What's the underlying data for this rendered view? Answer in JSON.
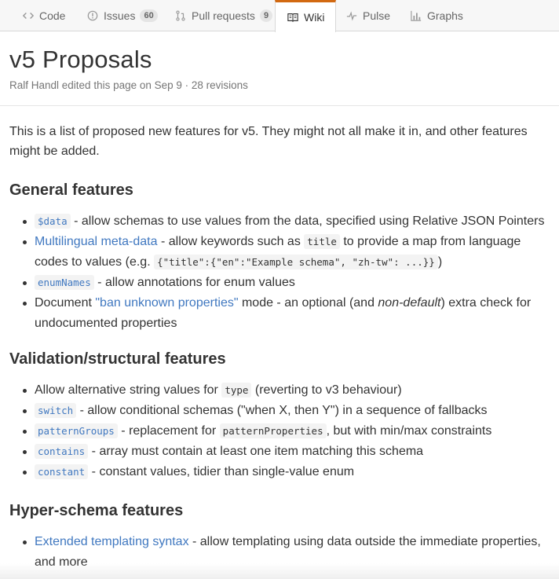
{
  "tabs": [
    {
      "label": "Code",
      "icon": "code-icon"
    },
    {
      "label": "Issues",
      "icon": "issue-opened-icon",
      "count": "60"
    },
    {
      "label": "Pull requests",
      "icon": "git-pull-request-icon",
      "count": "9"
    },
    {
      "label": "Wiki",
      "icon": "book-icon",
      "active": true
    },
    {
      "label": "Pulse",
      "icon": "pulse-icon"
    },
    {
      "label": "Graphs",
      "icon": "graph-icon"
    }
  ],
  "page": {
    "title": "v5 Proposals",
    "meta": "Ralf Handl edited this page on Sep 9 · 28 revisions",
    "intro": "This is a list of proposed new features for v5. They might not all make it in, and other features might be added."
  },
  "sections": {
    "general": {
      "heading": "General features",
      "i0": {
        "code": "$data",
        "text": " - allow schemas to use values from the data, specified using Relative JSON Pointers"
      },
      "i1": {
        "link": "Multilingual meta-data",
        "text_a": " - allow keywords such as ",
        "code_a": "title",
        "text_b": " to provide a map from language codes to values (e.g. ",
        "code_b": "{\"title\":{\"en\":\"Example schema\", \"zh-tw\": ...}}",
        "text_c": ")"
      },
      "i2": {
        "code": "enumNames",
        "text": " - allow annotations for enum values"
      },
      "i3": {
        "text_a": "Document ",
        "link": "\"ban unknown properties\"",
        "text_b": " mode - an optional (and ",
        "em": "non-default",
        "text_c": ") extra check for undocumented properties"
      }
    },
    "validation": {
      "heading": "Validation/structural features",
      "i0": {
        "text_a": "Allow alternative string values for ",
        "code": "type",
        "text_b": " (reverting to v3 behaviour)"
      },
      "i1": {
        "code": "switch",
        "text": " - allow conditional schemas (\"when X, then Y\") in a sequence of fallbacks"
      },
      "i2": {
        "code": "patternGroups",
        "text_a": " - replacement for ",
        "code_b": "patternProperties",
        "text_b": ", but with min/max constraints"
      },
      "i3": {
        "code": "contains",
        "text": " - array must contain at least one item matching this schema"
      },
      "i4": {
        "code": "constant",
        "text": " - constant values, tidier than single-value enum"
      }
    },
    "hyper": {
      "heading": "Hyper-schema features",
      "i0": {
        "link": "Extended templating syntax",
        "text": " - allow templating using data outside the immediate properties, and more"
      }
    }
  },
  "colors": {
    "link": "#4078c0",
    "active_tab_accent": "#d26911"
  }
}
